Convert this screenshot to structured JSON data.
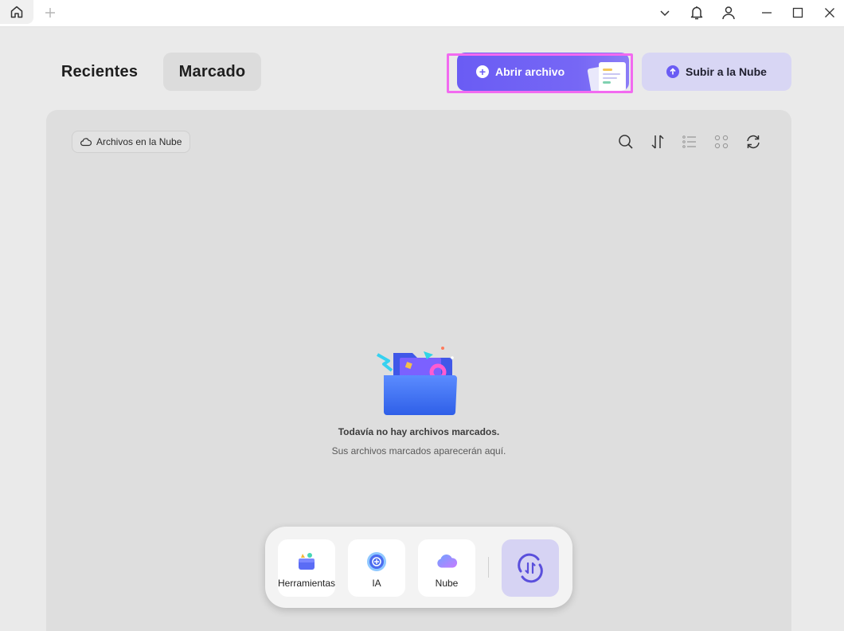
{
  "titlebar": {
    "home_icon": "home-icon",
    "new_tab_icon": "plus-icon",
    "controls": [
      "chevron-down-icon",
      "bell-icon",
      "user-icon",
      "minimize-icon",
      "maximize-icon",
      "close-icon"
    ]
  },
  "tabs": {
    "recientes": "Recientes",
    "marcado": "Marcado"
  },
  "actions": {
    "open_file": "Abrir archivo",
    "upload_cloud": "Subir a la Nube"
  },
  "panel": {
    "cloud_filter": "Archivos en la Nube",
    "tools": [
      "search-icon",
      "sort-icon",
      "list-view-icon",
      "grid-view-icon",
      "refresh-icon"
    ],
    "empty_title": "Todavía no hay archivos marcados.",
    "empty_subtitle": "Sus archivos marcados aparecerán aquí."
  },
  "dock": {
    "items": [
      {
        "label": "Herramientas",
        "icon": "toolbox-icon"
      },
      {
        "label": "IA",
        "icon": "ai-icon"
      },
      {
        "label": "Nube",
        "icon": "cloud-icon"
      }
    ],
    "convert_icon": "convert-icon"
  },
  "colors": {
    "accent": "#6a5cf4",
    "accent_light": "#d8d6f4",
    "highlight": "#f26af0"
  }
}
